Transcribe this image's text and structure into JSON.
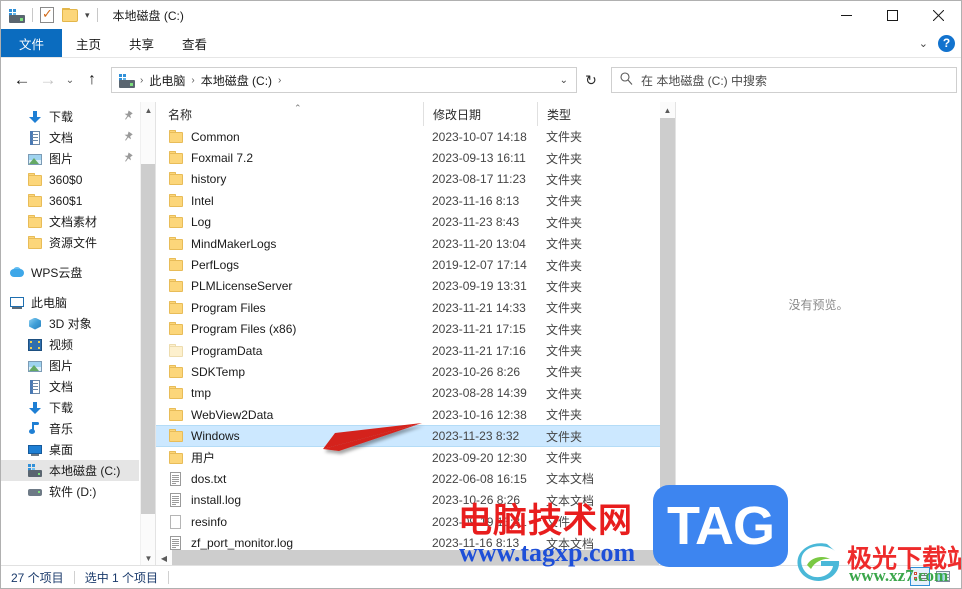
{
  "window": {
    "title": "本地磁盘 (C:)",
    "quick_access": [
      "drive-icon",
      "properties-icon",
      "new-folder-icon"
    ],
    "customize_chevron": "▾",
    "minimize": "—",
    "maximize": "☐",
    "close": "✕"
  },
  "ribbon": {
    "tabs": [
      {
        "label": "文件",
        "active": true
      },
      {
        "label": "主页",
        "active": false
      },
      {
        "label": "共享",
        "active": false
      },
      {
        "label": "查看",
        "active": false
      }
    ],
    "collapse_chevron": "⌄",
    "help_label": "?"
  },
  "address": {
    "back": "←",
    "forward": "→",
    "recent": "⌄",
    "up": "↑",
    "crumbs": [
      "此电脑",
      "本地磁盘 (C:)"
    ],
    "crumb_sep": "›",
    "dropdown_chevron": "⌄",
    "refresh": "↻"
  },
  "search": {
    "icon": "search-icon",
    "placeholder": "在 本地磁盘 (C:) 中搜索"
  },
  "sidebar": {
    "groups": [
      {
        "items": [
          {
            "label": "下载",
            "icon": "download-icon",
            "indent": 1,
            "pinned": true,
            "selected": false
          },
          {
            "label": "文档",
            "icon": "document-icon",
            "indent": 1,
            "pinned": true,
            "selected": false
          },
          {
            "label": "图片",
            "icon": "pictures-icon",
            "indent": 1,
            "pinned": true,
            "selected": false
          },
          {
            "label": "360$0",
            "icon": "folder-icon",
            "indent": 1,
            "pinned": false,
            "selected": false
          },
          {
            "label": "360$1",
            "icon": "folder-icon",
            "indent": 1,
            "pinned": false,
            "selected": false
          },
          {
            "label": "文档素材",
            "icon": "folder-icon",
            "indent": 1,
            "pinned": false,
            "selected": false
          },
          {
            "label": "资源文件",
            "icon": "folder-icon",
            "indent": 1,
            "pinned": false,
            "selected": false
          }
        ]
      },
      {
        "items": [
          {
            "label": "WPS云盘",
            "icon": "cloud-icon",
            "indent": 0,
            "pinned": false,
            "selected": false
          }
        ]
      },
      {
        "items": [
          {
            "label": "此电脑",
            "icon": "pc-icon",
            "indent": 0,
            "pinned": false,
            "selected": false
          },
          {
            "label": "3D 对象",
            "icon": "3d-objects-icon",
            "indent": 1,
            "pinned": false,
            "selected": false
          },
          {
            "label": "视频",
            "icon": "video-icon",
            "indent": 1,
            "pinned": false,
            "selected": false
          },
          {
            "label": "图片",
            "icon": "pictures-icon",
            "indent": 1,
            "pinned": false,
            "selected": false
          },
          {
            "label": "文档",
            "icon": "document-icon",
            "indent": 1,
            "pinned": false,
            "selected": false
          },
          {
            "label": "下载",
            "icon": "download-icon",
            "indent": 1,
            "pinned": false,
            "selected": false
          },
          {
            "label": "音乐",
            "icon": "music-icon",
            "indent": 1,
            "pinned": false,
            "selected": false
          },
          {
            "label": "桌面",
            "icon": "desktop-icon",
            "indent": 1,
            "pinned": false,
            "selected": false
          },
          {
            "label": "本地磁盘 (C:)",
            "icon": "drive-icon",
            "indent": 1,
            "pinned": false,
            "selected": true
          },
          {
            "label": "软件 (D:)",
            "icon": "hdd-icon",
            "indent": 1,
            "pinned": false,
            "selected": false
          }
        ]
      }
    ]
  },
  "filelist": {
    "columns": [
      {
        "key": "name",
        "label": "名称",
        "sorted": true,
        "sort_caret": "⌃"
      },
      {
        "key": "date",
        "label": "修改日期"
      },
      {
        "key": "type",
        "label": "类型"
      }
    ],
    "rows": [
      {
        "name": "Common",
        "date": "2023-10-07 14:18",
        "type": "文件夹",
        "icon": "folder-icon",
        "selected": false
      },
      {
        "name": "Foxmail 7.2",
        "date": "2023-09-13 16:11",
        "type": "文件夹",
        "icon": "folder-icon",
        "selected": false
      },
      {
        "name": "history",
        "date": "2023-08-17 11:23",
        "type": "文件夹",
        "icon": "folder-icon",
        "selected": false
      },
      {
        "name": "Intel",
        "date": "2023-11-16 8:13",
        "type": "文件夹",
        "icon": "folder-icon",
        "selected": false
      },
      {
        "name": "Log",
        "date": "2023-11-23 8:43",
        "type": "文件夹",
        "icon": "folder-icon",
        "selected": false
      },
      {
        "name": "MindMakerLogs",
        "date": "2023-11-20 13:04",
        "type": "文件夹",
        "icon": "folder-icon",
        "selected": false
      },
      {
        "name": "PerfLogs",
        "date": "2019-12-07 17:14",
        "type": "文件夹",
        "icon": "folder-icon",
        "selected": false
      },
      {
        "name": "PLMLicenseServer",
        "date": "2023-09-19 13:31",
        "type": "文件夹",
        "icon": "folder-icon",
        "selected": false
      },
      {
        "name": "Program Files",
        "date": "2023-11-21 14:33",
        "type": "文件夹",
        "icon": "folder-icon",
        "selected": false
      },
      {
        "name": "Program Files (x86)",
        "date": "2023-11-21 17:15",
        "type": "文件夹",
        "icon": "folder-icon",
        "selected": false
      },
      {
        "name": "ProgramData",
        "date": "2023-11-21 17:16",
        "type": "文件夹",
        "icon": "folder-hidden-icon",
        "selected": false
      },
      {
        "name": "SDKTemp",
        "date": "2023-10-26 8:26",
        "type": "文件夹",
        "icon": "folder-icon",
        "selected": false
      },
      {
        "name": "tmp",
        "date": "2023-08-28 14:39",
        "type": "文件夹",
        "icon": "folder-icon",
        "selected": false
      },
      {
        "name": "WebView2Data",
        "date": "2023-10-16 12:38",
        "type": "文件夹",
        "icon": "folder-icon",
        "selected": false
      },
      {
        "name": "Windows",
        "date": "2023-11-23 8:32",
        "type": "文件夹",
        "icon": "folder-icon",
        "selected": true
      },
      {
        "name": "用户",
        "date": "2023-09-20 12:30",
        "type": "文件夹",
        "icon": "folder-icon",
        "selected": false
      },
      {
        "name": "dos.txt",
        "date": "2022-06-08 16:15",
        "type": "文本文档",
        "icon": "text-file-icon",
        "selected": false
      },
      {
        "name": "install.log",
        "date": "2023-10-26 8:26",
        "type": "文本文档",
        "icon": "text-file-icon",
        "selected": false
      },
      {
        "name": "resinfo",
        "date": "2023-09-19 13:31",
        "type": "文件",
        "icon": "blank-file-icon",
        "selected": false
      },
      {
        "name": "zf_port_monitor.log",
        "date": "2023-11-16 8:13",
        "type": "文本文档",
        "icon": "text-file-icon",
        "selected": false
      }
    ]
  },
  "preview": {
    "message": "没有预览。"
  },
  "status": {
    "item_count": "27 个项目",
    "selection": "选中 1 个项目",
    "view_details": "details-view-icon",
    "view_tiles": "tiles-view-icon"
  },
  "watermarks": {
    "cn_text": "电脑技术网",
    "url_text": "www.tagxp.com",
    "tag_text": "TAG",
    "jg_cn": "极光下载站",
    "jg_url": "www.xz7.com"
  },
  "colors": {
    "accent": "#0b6cbf",
    "selection": "#cce8ff",
    "arrow_red": "#d4201a",
    "watermark_red": "#e81d1d",
    "watermark_blue": "#1e4fd8",
    "tag_blue": "#3d85f0"
  }
}
